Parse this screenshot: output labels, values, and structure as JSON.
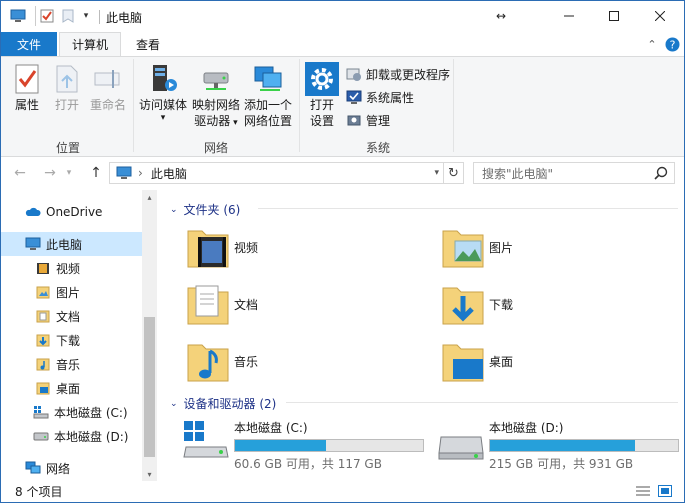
{
  "window": {
    "title": "此电脑"
  },
  "tabs": {
    "file": "文件",
    "computer": "计算机",
    "view": "查看"
  },
  "ribbon": {
    "location": {
      "label": "位置",
      "properties": "属性",
      "open": "打开",
      "rename": "重命名"
    },
    "network": {
      "label": "网络",
      "access_media": "访问媒体",
      "map_drive_1": "映射网络",
      "map_drive_2": "驱动器",
      "add_location_1": "添加一个",
      "add_location_2": "网络位置"
    },
    "system": {
      "label": "系统",
      "open_settings_1": "打开",
      "open_settings_2": "设置",
      "uninstall": "卸载或更改程序",
      "system_properties": "系统属性",
      "manage": "管理"
    }
  },
  "nav": {
    "address": "此电脑",
    "search_placeholder": "搜索\"此电脑\""
  },
  "sidebar": {
    "items": [
      {
        "label": "OneDrive"
      },
      {
        "label": "此电脑"
      },
      {
        "label": "视频"
      },
      {
        "label": "图片"
      },
      {
        "label": "文档"
      },
      {
        "label": "下载"
      },
      {
        "label": "音乐"
      },
      {
        "label": "桌面"
      },
      {
        "label": "本地磁盘 (C:)"
      },
      {
        "label": "本地磁盘 (D:)"
      },
      {
        "label": "网络"
      }
    ]
  },
  "folders": {
    "header": "文件夹 (6)",
    "items": [
      {
        "label": "视频"
      },
      {
        "label": "图片"
      },
      {
        "label": "文档"
      },
      {
        "label": "下载"
      },
      {
        "label": "音乐"
      },
      {
        "label": "桌面"
      }
    ]
  },
  "devices": {
    "header": "设备和驱动器 (2)",
    "items": [
      {
        "label": "本地磁盘 (C:)",
        "free": "60.6 GB 可用，共 117 GB",
        "used_fraction": 0.482
      },
      {
        "label": "本地磁盘 (D:)",
        "free": "215 GB 可用，共 931 GB",
        "used_fraction": 0.769
      }
    ]
  },
  "status": {
    "count": "8 个项目"
  },
  "colors": {
    "accent": "#1979ca",
    "selection": "#cce8ff",
    "section_text": "#1e3287",
    "bar_fill": "#26a0da"
  }
}
